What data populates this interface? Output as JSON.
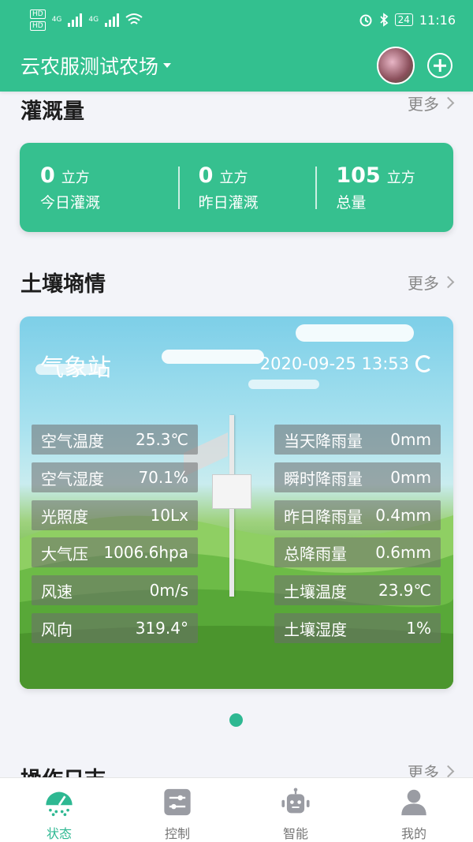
{
  "status_bar": {
    "hd1": "HD",
    "hd2": "HD",
    "net1": "4G",
    "net2": "4G",
    "battery": "24",
    "time": "11:16"
  },
  "header": {
    "farm_name": "云农服测试农场"
  },
  "irrigation": {
    "title": "灌溉量",
    "more": "更多",
    "items": [
      {
        "value": "0",
        "unit": "立方",
        "label": "今日灌溉"
      },
      {
        "value": "0",
        "unit": "立方",
        "label": "昨日灌溉"
      },
      {
        "value": "105",
        "unit": "立方",
        "label": "总量"
      }
    ]
  },
  "soil": {
    "title": "土壤墒情",
    "more": "更多"
  },
  "station": {
    "name": "气象站",
    "time": "2020-09-25 13:53",
    "left": [
      {
        "label": "空气温度",
        "value": "25.3℃"
      },
      {
        "label": "空气湿度",
        "value": "70.1%"
      },
      {
        "label": "光照度",
        "value": "10Lx"
      },
      {
        "label": "大气压",
        "value": "1006.6hpa"
      },
      {
        "label": "风速",
        "value": "0m/s"
      },
      {
        "label": "风向",
        "value": "319.4°"
      }
    ],
    "right": [
      {
        "label": "当天降雨量",
        "value": "0mm"
      },
      {
        "label": "瞬时降雨量",
        "value": "0mm"
      },
      {
        "label": "昨日降雨量",
        "value": "0.4mm"
      },
      {
        "label": "总降雨量",
        "value": "0.6mm"
      },
      {
        "label": "土壤温度",
        "value": "23.9℃"
      },
      {
        "label": "土壤湿度",
        "value": "1%"
      }
    ]
  },
  "log": {
    "title": "操作日志",
    "more": "更多"
  },
  "nav": [
    {
      "label": "状态",
      "icon": "gauge-icon",
      "active": true
    },
    {
      "label": "控制",
      "icon": "sliders-icon",
      "active": false
    },
    {
      "label": "智能",
      "icon": "robot-icon",
      "active": false
    },
    {
      "label": "我的",
      "icon": "person-icon",
      "active": false
    }
  ],
  "colors": {
    "brand": "#33c08f",
    "active_nav": "#2eb892"
  }
}
